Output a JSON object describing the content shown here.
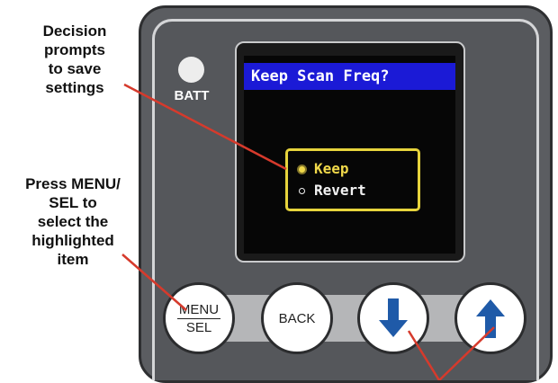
{
  "callouts": {
    "decision": "Decision\nprompts\nto save\nsettings",
    "press": "Press MENU/\nSEL to\nselect the\nhighlighted\nitem"
  },
  "indicator": {
    "label": "BATT"
  },
  "screen": {
    "title": "Keep Scan Freq?",
    "options": [
      {
        "label": "Keep",
        "selected": true
      },
      {
        "label": "Revert",
        "selected": false
      }
    ]
  },
  "buttons": {
    "menu_top": "MENU",
    "menu_bottom": "SEL",
    "back": "BACK",
    "down_icon": "arrow-down-icon",
    "up_icon": "arrow-up-icon"
  },
  "colors": {
    "panel": "#5b5d61",
    "title_bar": "#1b1ad6",
    "highlight": "#f0d84a",
    "leader_line": "#d63a2c",
    "arrow_blue": "#1f5aa8"
  }
}
